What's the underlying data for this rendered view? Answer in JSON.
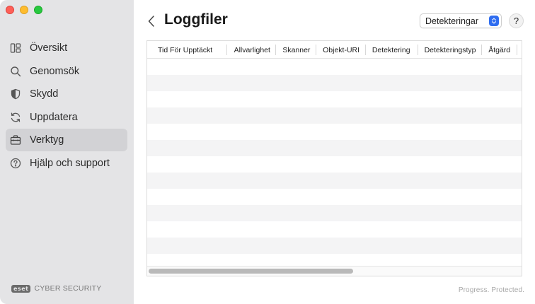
{
  "window": {
    "controls": [
      "close",
      "minimize",
      "zoom"
    ]
  },
  "sidebar": {
    "items": [
      {
        "label": "Översikt",
        "icon": "overview-icon"
      },
      {
        "label": "Genomsök",
        "icon": "search-icon"
      },
      {
        "label": "Skydd",
        "icon": "shield-icon"
      },
      {
        "label": "Uppdatera",
        "icon": "refresh-icon"
      },
      {
        "label": "Verktyg",
        "icon": "briefcase-icon",
        "active": true
      },
      {
        "label": "Hjälp och support",
        "icon": "help-circle-icon"
      }
    ],
    "brand": {
      "logo": "eset",
      "product": "CYBER SECURITY"
    }
  },
  "header": {
    "title": "Loggfiler",
    "filter_value": "Detekteringar",
    "help_label": "?"
  },
  "table": {
    "columns": [
      "Tid För Upptäckt",
      "Allvarlighet",
      "Skanner",
      "Objekt-URI",
      "Detektering",
      "Detekteringstyp",
      "Åtgärd"
    ],
    "rows": []
  },
  "footer": {
    "tagline": "Progress. Protected."
  },
  "colors": {
    "sidebar_bg": "#e4e4e6",
    "active_item_bg": "#d2d2d5",
    "accent": "#2f6df0",
    "row_alt": "#f4f4f5"
  }
}
